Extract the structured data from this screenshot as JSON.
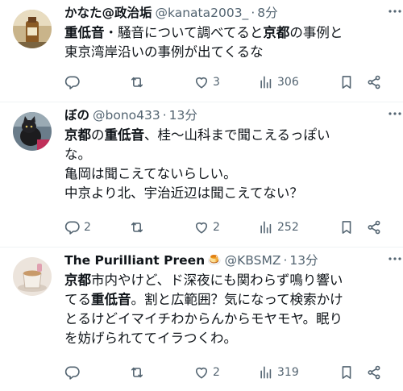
{
  "tweets": [
    {
      "name": "かなた@政治垢",
      "handle": "@kanata2003_",
      "separator": "·",
      "time": "8分",
      "text_lines": [
        [
          {
            "t": "重低音",
            "b": true
          },
          {
            "t": "・騒音について調べてると",
            "b": false
          },
          {
            "t": "京都",
            "b": true
          },
          {
            "t": "の事例と",
            "b": false
          }
        ],
        [
          {
            "t": "東京湾岸沿いの事例が出てくるな",
            "b": false
          }
        ]
      ],
      "replies": "",
      "retweets": "",
      "likes": "3",
      "views": "306"
    },
    {
      "name": "ぼの",
      "handle": "@bono433",
      "separator": "·",
      "time": "13分",
      "text_lines": [
        [
          {
            "t": "京都",
            "b": true
          },
          {
            "t": "の",
            "b": false
          },
          {
            "t": "重低音",
            "b": true
          },
          {
            "t": "、桂〜山科まで聞こえるっぽい",
            "b": false
          }
        ],
        [
          {
            "t": "な。",
            "b": false
          }
        ],
        [
          {
            "t": "亀岡は聞こえてないらしい。",
            "b": false
          }
        ],
        [
          {
            "t": "中京より北、宇治近辺は聞こえてない？",
            "b": false
          }
        ]
      ],
      "replies": "2",
      "retweets": "",
      "likes": "2",
      "views": "252"
    },
    {
      "name": "The Purilliant Preen",
      "name_emoji": "🍮",
      "handle": "@KBSMZ",
      "separator": "·",
      "time": "13分",
      "text_lines": [
        [
          {
            "t": "京都",
            "b": true
          },
          {
            "t": "市内やけど、ド深夜にも関わらず鳴り響い",
            "b": false
          }
        ],
        [
          {
            "t": "てる",
            "b": false
          },
          {
            "t": "重低音",
            "b": true
          },
          {
            "t": "。割と広範囲？気になって検索かけ",
            "b": false
          }
        ],
        [
          {
            "t": "とるけどイマイチわからんからモヤモヤ。眠り",
            "b": false
          }
        ],
        [
          {
            "t": "を妨げられててイラつくわ。",
            "b": false
          }
        ]
      ],
      "replies": "",
      "retweets": "",
      "likes": "2",
      "views": "319"
    }
  ],
  "icons": {
    "reply": "reply-icon",
    "retweet": "retweet-icon",
    "like": "heart-icon",
    "views": "views-icon",
    "bookmark": "bookmark-icon",
    "share": "share-icon",
    "more": "more-icon"
  },
  "colors": {
    "text": "#0f1419",
    "secondary": "#536471",
    "divider": "#eff3f4"
  }
}
